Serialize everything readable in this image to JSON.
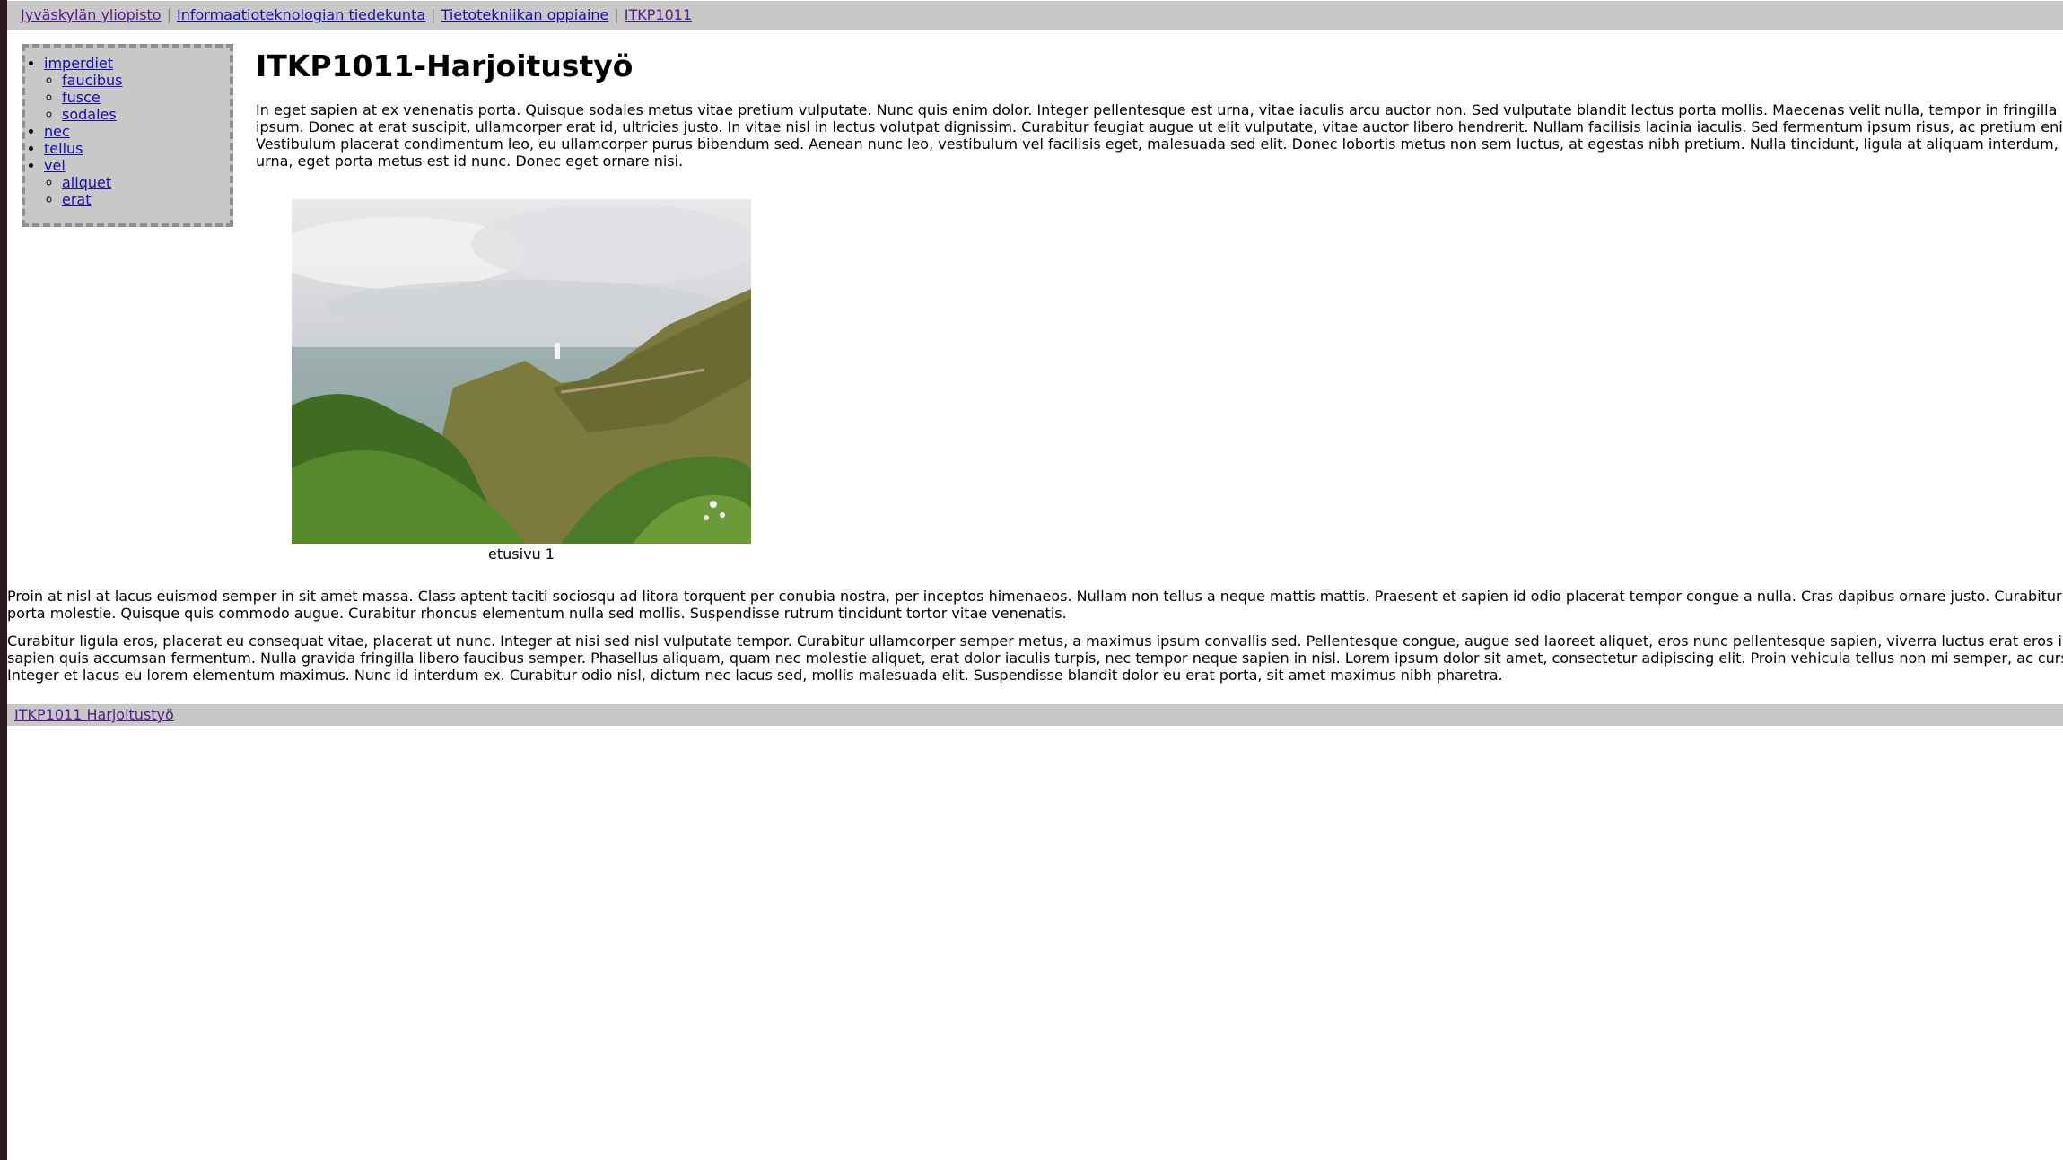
{
  "breadcrumb": [
    {
      "label": "Jyväskylän yliopisto",
      "visited": true
    },
    {
      "label": "Informaatioteknologian tiedekunta",
      "visited": false
    },
    {
      "label": "Tietotekniikan oppiaine",
      "visited": false
    },
    {
      "label": "ITKP1011",
      "visited": true
    }
  ],
  "breadcrumb_separator": "|",
  "nav": {
    "items": [
      {
        "label": "imperdiet",
        "children": [
          "faucibus",
          "fusce",
          "sodales"
        ]
      },
      {
        "label": "nec",
        "children": []
      },
      {
        "label": "tellus",
        "children": []
      },
      {
        "label": "vel",
        "children": [
          "aliquet",
          "erat"
        ]
      }
    ]
  },
  "main": {
    "title": "ITKP1011-Harjoitustyö",
    "intro": "In eget sapien at ex venenatis porta. Quisque sodales metus vitae pretium vulputate. Nunc quis enim dolor. Integer pellentesque est urna, vitae iaculis arcu auctor non. Sed vulputate blandit lectus porta mollis. Maecenas velit nulla, tempor in fringilla ipsum. Donec at erat suscipit, ullamcorper erat id, ultricies justo. In vitae nisl in lectus volutpat dignissim. Curabitur feugiat augue ut elit vulputate, vitae auctor libero hendrerit. Nullam facilisis lacinia iaculis. Sed fermentum ipsum risus, ac pretium eni Vestibulum placerat condimentum leo, eu ullamcorper purus bibendum sed. Aenean nunc leo, vestibulum vel facilisis eget, malesuada sed elit. Donec lobortis metus non sem luctus, at egestas nibh pretium. Nulla tincidunt, ligula at aliquam interdum, urna, eget porta metus est id nunc. Donec eget ornare nisi.",
    "figure_caption": "etusivu 1",
    "paragraph1": "Proin at nisl at lacus euismod semper in sit amet massa. Class aptent taciti sociosqu ad litora torquent per conubia nostra, per inceptos himenaeos. Nullam non tellus a neque mattis mattis. Praesent et sapien id odio placerat tempor congue a nulla. Cras dapibus ornare justo. Curabitur porta molestie. Quisque quis commodo augue. Curabitur rhoncus elementum nulla sed mollis. Suspendisse rutrum tincidunt tortor vitae venenatis.",
    "paragraph2": "Curabitur ligula eros, placerat eu consequat vitae, placerat ut nunc. Integer at nisi sed nisl vulputate tempor. Curabitur ullamcorper semper metus, a maximus ipsum convallis sed. Pellentesque congue, augue sed laoreet aliquet, eros nunc pellentesque sapien, viverra luctus erat eros i sapien quis accumsan fermentum. Nulla gravida fringilla libero faucibus semper. Phasellus aliquam, quam nec molestie aliquet, erat dolor iaculis turpis, nec tempor neque sapien in nisl. Lorem ipsum dolor sit amet, consectetur adipiscing elit. Proin vehicula tellus non mi semper, ac curs Integer et lacus eu lorem elementum maximus. Nunc id interdum ex. Curabitur odio nisl, dictum nec lacus sed, mollis malesuada elit. Suspendisse blandit dolor eu erat porta, sit amet maximus nibh pharetra."
  },
  "footer": {
    "link": "ITKP1011 Harjoitustyö"
  },
  "colors": {
    "bar_gray": "#c8c8c8",
    "link": "#1a0dab",
    "visited": "#551a8b"
  }
}
